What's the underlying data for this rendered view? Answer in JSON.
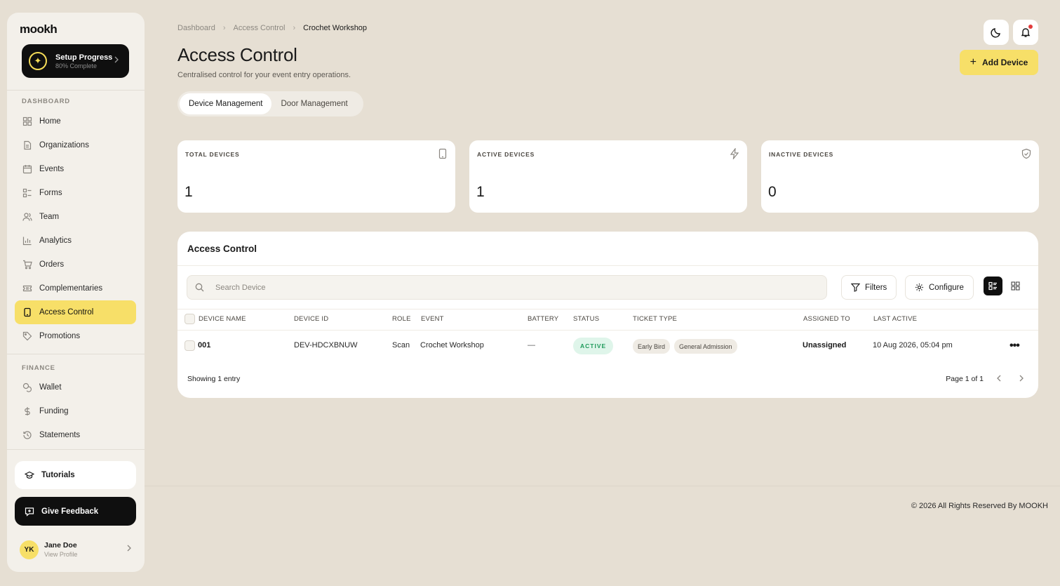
{
  "sidebar": {
    "logo": "mookh",
    "setup": {
      "title": "Setup Progress",
      "subtitle": "80% Complete",
      "progress": 0.8
    },
    "sections": {
      "dashboard_label": "DASHBOARD",
      "finance_label": "FINANCE"
    },
    "dashboard_items": [
      {
        "label": "Home",
        "icon": "grid-icon"
      },
      {
        "label": "Organizations",
        "icon": "document-icon"
      },
      {
        "label": "Events",
        "icon": "calendar-icon"
      },
      {
        "label": "Forms",
        "icon": "form-icon"
      },
      {
        "label": "Team",
        "icon": "users-icon"
      },
      {
        "label": "Analytics",
        "icon": "bar-chart-icon"
      },
      {
        "label": "Orders",
        "icon": "cart-icon"
      },
      {
        "label": "Complementaries",
        "icon": "ticket-icon"
      },
      {
        "label": "Access Control",
        "icon": "device-icon",
        "active": true
      },
      {
        "label": "Promotions",
        "icon": "tag-icon"
      }
    ],
    "finance_items": [
      {
        "label": "Wallet",
        "icon": "coins-icon"
      },
      {
        "label": "Funding",
        "icon": "dollar-icon"
      },
      {
        "label": "Statements",
        "icon": "history-icon"
      }
    ],
    "tutorials_label": "Tutorials",
    "feedback_label": "Give Feedback",
    "profile": {
      "initials": "YK",
      "name": "Jane Doe",
      "link": "View Profile"
    }
  },
  "header": {
    "breadcrumb": [
      "Dashboard",
      "Access Control",
      "Crochet Workshop"
    ],
    "title": "Access Control",
    "subtitle": "Centralised control for your event entry operations.",
    "add_device_label": "Add Device"
  },
  "tabs": [
    {
      "label": "Device Management",
      "active": true
    },
    {
      "label": "Door Management",
      "active": false
    }
  ],
  "stats": [
    {
      "label": "TOTAL DEVICES",
      "value": "1",
      "icon": "tablet-icon"
    },
    {
      "label": "ACTIVE DEVICES",
      "value": "1",
      "icon": "bolt-icon"
    },
    {
      "label": "INACTIVE DEVICES",
      "value": "0",
      "icon": "shield-check-icon"
    }
  ],
  "panel": {
    "title": "Access Control",
    "search_placeholder": "Search Device",
    "filters_label": "Filters",
    "configure_label": "Configure",
    "columns": [
      "DEVICE NAME",
      "DEVICE ID",
      "ROLE",
      "EVENT",
      "BATTERY",
      "STATUS",
      "TICKET TYPE",
      "ASSIGNED TO",
      "LAST ACTIVE"
    ],
    "rows": [
      {
        "device_name": "001",
        "device_id": "DEV-HDCXBNUW",
        "role": "Scan",
        "event": "Crochet Workshop",
        "battery": "—",
        "status": "ACTIVE",
        "ticket_types": [
          "Early Bird",
          "General Admission"
        ],
        "assigned_to": "Unassigned",
        "last_active": "10 Aug 2026, 05:04 pm"
      }
    ],
    "showing": "Showing 1 entry",
    "page_info": "Page 1 of 1"
  },
  "footer": {
    "copyright": "© 2026 All Rights Reserved By MOOKH"
  }
}
